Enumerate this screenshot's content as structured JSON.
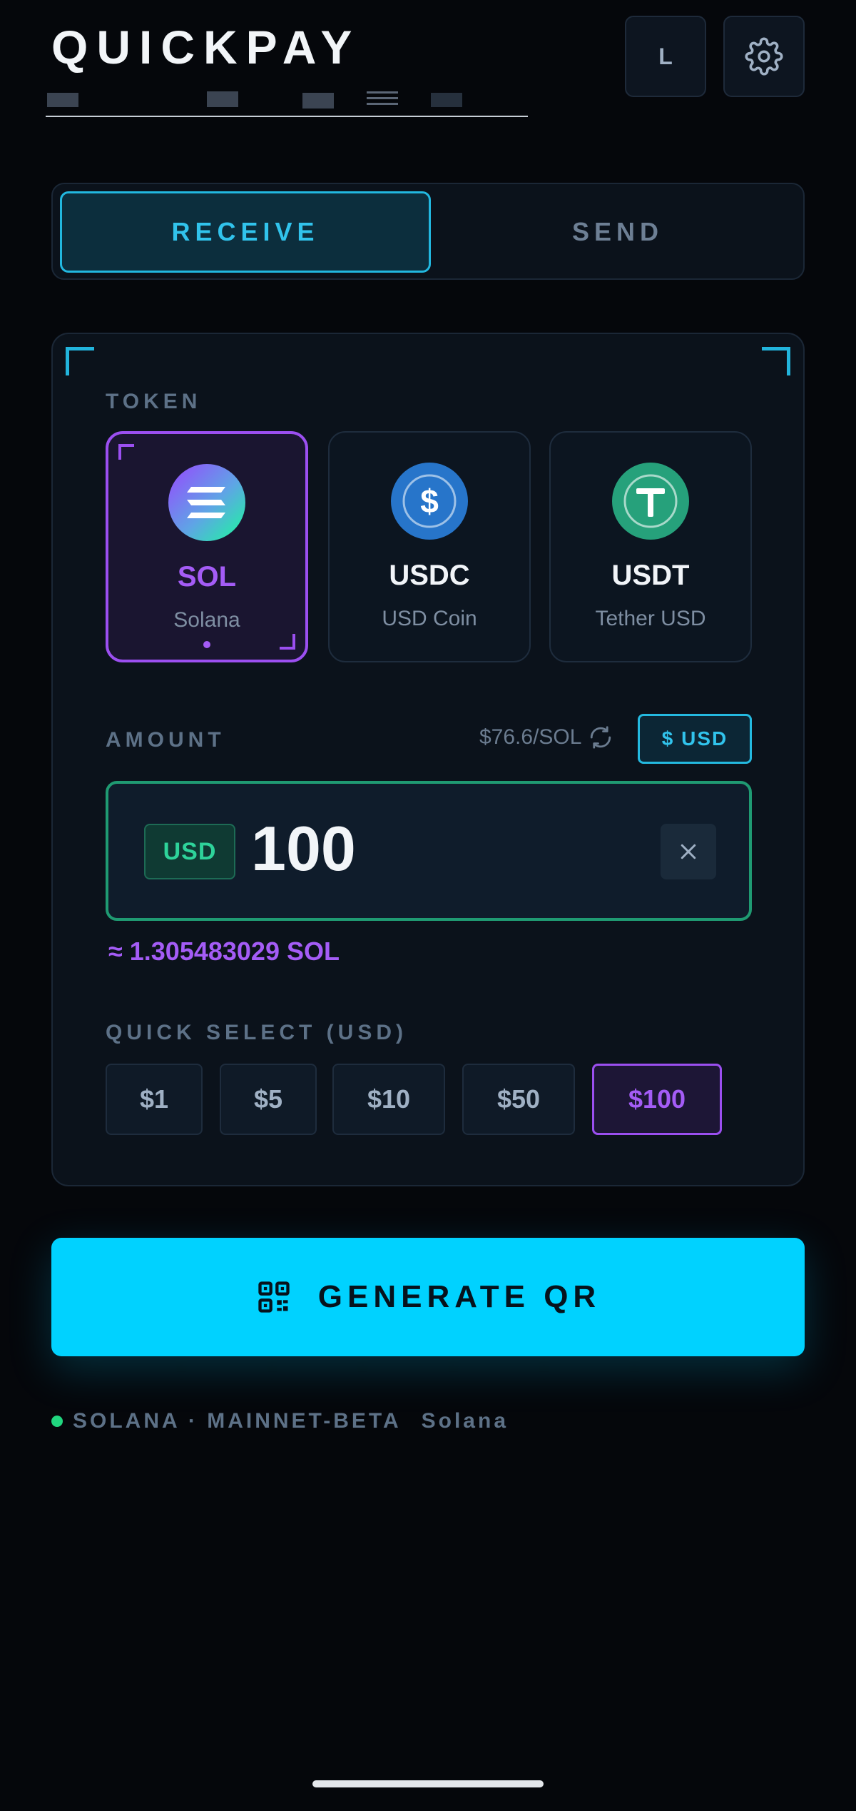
{
  "header": {
    "brand": "QUICKPAY",
    "avatar_letter": "L",
    "settings_icon": "gear-icon"
  },
  "mode_tabs": [
    {
      "label": "RECEIVE",
      "active": true
    },
    {
      "label": "SEND",
      "active": false
    }
  ],
  "token_section": {
    "label": "TOKEN",
    "tokens": [
      {
        "symbol": "SOL",
        "name": "Solana",
        "selected": true,
        "icon": "solana-icon",
        "color": "#9945ff"
      },
      {
        "symbol": "USDC",
        "name": "USD Coin",
        "selected": false,
        "icon": "usdc-icon",
        "color": "#2775ca"
      },
      {
        "symbol": "USDT",
        "name": "Tether USD",
        "selected": false,
        "icon": "tether-icon",
        "color": "#26a17b"
      }
    ]
  },
  "amount_section": {
    "label": "AMOUNT",
    "rate": "$76.6/SOL",
    "currency_toggle": "$ USD",
    "currency_tag": "USD",
    "value": "100",
    "converted": "≈ 1.305483029 SOL"
  },
  "quick_select": {
    "label": "QUICK SELECT (USD)",
    "options": [
      {
        "label": "$1",
        "selected": false
      },
      {
        "label": "$5",
        "selected": false
      },
      {
        "label": "$10",
        "selected": false
      },
      {
        "label": "$50",
        "selected": false
      },
      {
        "label": "$100",
        "selected": true
      }
    ]
  },
  "generate_button": {
    "label": "GENERATE QR",
    "icon": "qr-code-icon"
  },
  "status": {
    "network": "SOLANA · MAINNET-BETA",
    "chain": "Solana",
    "color": "#21d67f"
  },
  "colors": {
    "accent": "#00d2ff",
    "purple": "#a45cf6",
    "green": "#1f9a72"
  }
}
